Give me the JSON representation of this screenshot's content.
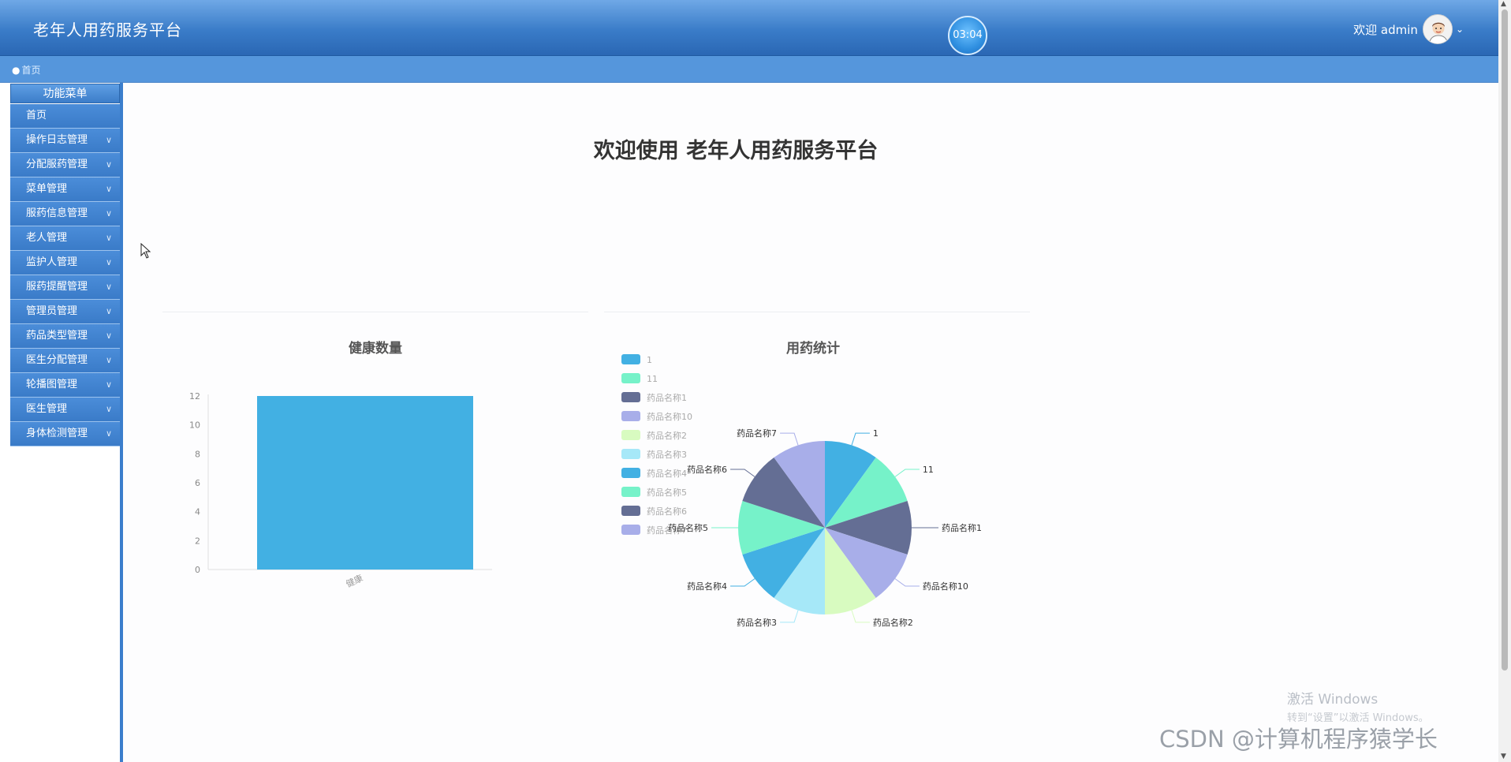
{
  "header": {
    "app_title": "老年人用药服务平台",
    "clock": "03:04",
    "welcome": "欢迎 admin"
  },
  "breadcrumb": {
    "home": "首页"
  },
  "sidebar": {
    "heading": "功能菜单",
    "items": [
      {
        "label": "首页",
        "expandable": false
      },
      {
        "label": "操作日志管理",
        "expandable": true
      },
      {
        "label": "分配服药管理",
        "expandable": true
      },
      {
        "label": "菜单管理",
        "expandable": true
      },
      {
        "label": "服药信息管理",
        "expandable": true
      },
      {
        "label": "老人管理",
        "expandable": true
      },
      {
        "label": "监护人管理",
        "expandable": true
      },
      {
        "label": "服药提醒管理",
        "expandable": true
      },
      {
        "label": "管理员管理",
        "expandable": true
      },
      {
        "label": "药品类型管理",
        "expandable": true
      },
      {
        "label": "医生分配管理",
        "expandable": true
      },
      {
        "label": "轮播图管理",
        "expandable": true
      },
      {
        "label": "医生管理",
        "expandable": true
      },
      {
        "label": "身体检测管理",
        "expandable": true
      }
    ]
  },
  "main": {
    "welcome_title": "欢迎使用 老年人用药服务平台"
  },
  "chart_data": [
    {
      "type": "bar",
      "title": "健康数量",
      "categories": [
        "健康"
      ],
      "values": [
        12
      ],
      "ylim": [
        0,
        12
      ],
      "yticks": [
        "0",
        "2",
        "4",
        "6",
        "8",
        "10",
        "12"
      ],
      "color": "#42b0e3"
    },
    {
      "type": "pie",
      "title": "用药统计",
      "legend_position": "top-left",
      "labels": [
        "1",
        "11",
        "药品名称1",
        "药品名称10",
        "药品名称2",
        "药品名称3",
        "药品名称4",
        "药品名称5",
        "药品名称6",
        "药品名称7"
      ],
      "values": [
        1,
        1,
        1,
        1,
        1,
        1,
        1,
        1,
        1,
        1
      ],
      "colors": [
        "#42b0e3",
        "#76f2c9",
        "#646e94",
        "#a8aee9",
        "#d8fbc0",
        "#a6e8f8",
        "#42b0e3",
        "#76f2c9",
        "#646e94",
        "#a8aee9"
      ]
    }
  ],
  "overlay": {
    "activate_title": "激活 Windows",
    "activate_sub": "转到“设置”以激活 Windows。",
    "watermark": "CSDN @计算机程序猿学长"
  },
  "icons": {
    "user_chevron": "chevron-down-icon",
    "menu_chevron": "chevron-down-icon",
    "cursor": "mouse-pointer-icon"
  }
}
